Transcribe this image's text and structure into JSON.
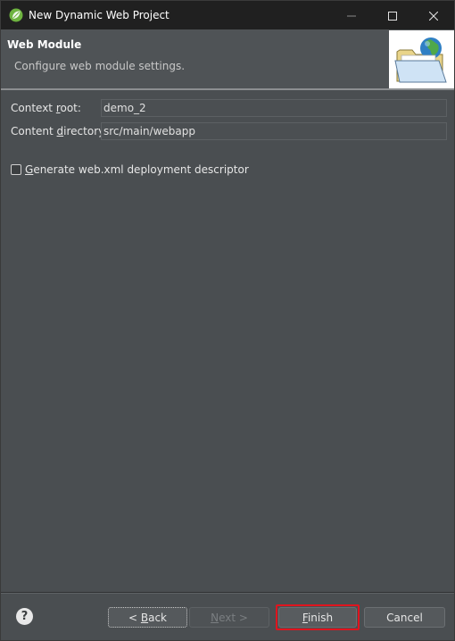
{
  "window": {
    "title": "New Dynamic Web Project"
  },
  "banner": {
    "title": "Web Module",
    "description": "Configure web module settings."
  },
  "form": {
    "context_root": {
      "label_prefix": "Context ",
      "label_mnemonic": "r",
      "label_suffix": "oot:",
      "value": "demo_2"
    },
    "content_directory": {
      "label_prefix": "Content ",
      "label_mnemonic": "d",
      "label_suffix": "irectory:",
      "value": "src/main/webapp"
    },
    "generate_webxml": {
      "label_mnemonic": "G",
      "label_suffix": "enerate web.xml deployment descriptor",
      "checked": false
    }
  },
  "buttons": {
    "help": "?",
    "back_prefix": "< ",
    "back_mnemonic": "B",
    "back_suffix": "ack",
    "next_mnemonic": "N",
    "next_suffix": "ext >",
    "finish_mnemonic": "F",
    "finish_suffix": "inish",
    "cancel": "Cancel"
  },
  "colors": {
    "dialog_background": "#4a4e51",
    "titlebar_background": "#202020",
    "finish_highlight": "#e0141e"
  },
  "icons": {
    "app": "spring-leaf-icon",
    "banner": "web-folder-globe-icon"
  }
}
